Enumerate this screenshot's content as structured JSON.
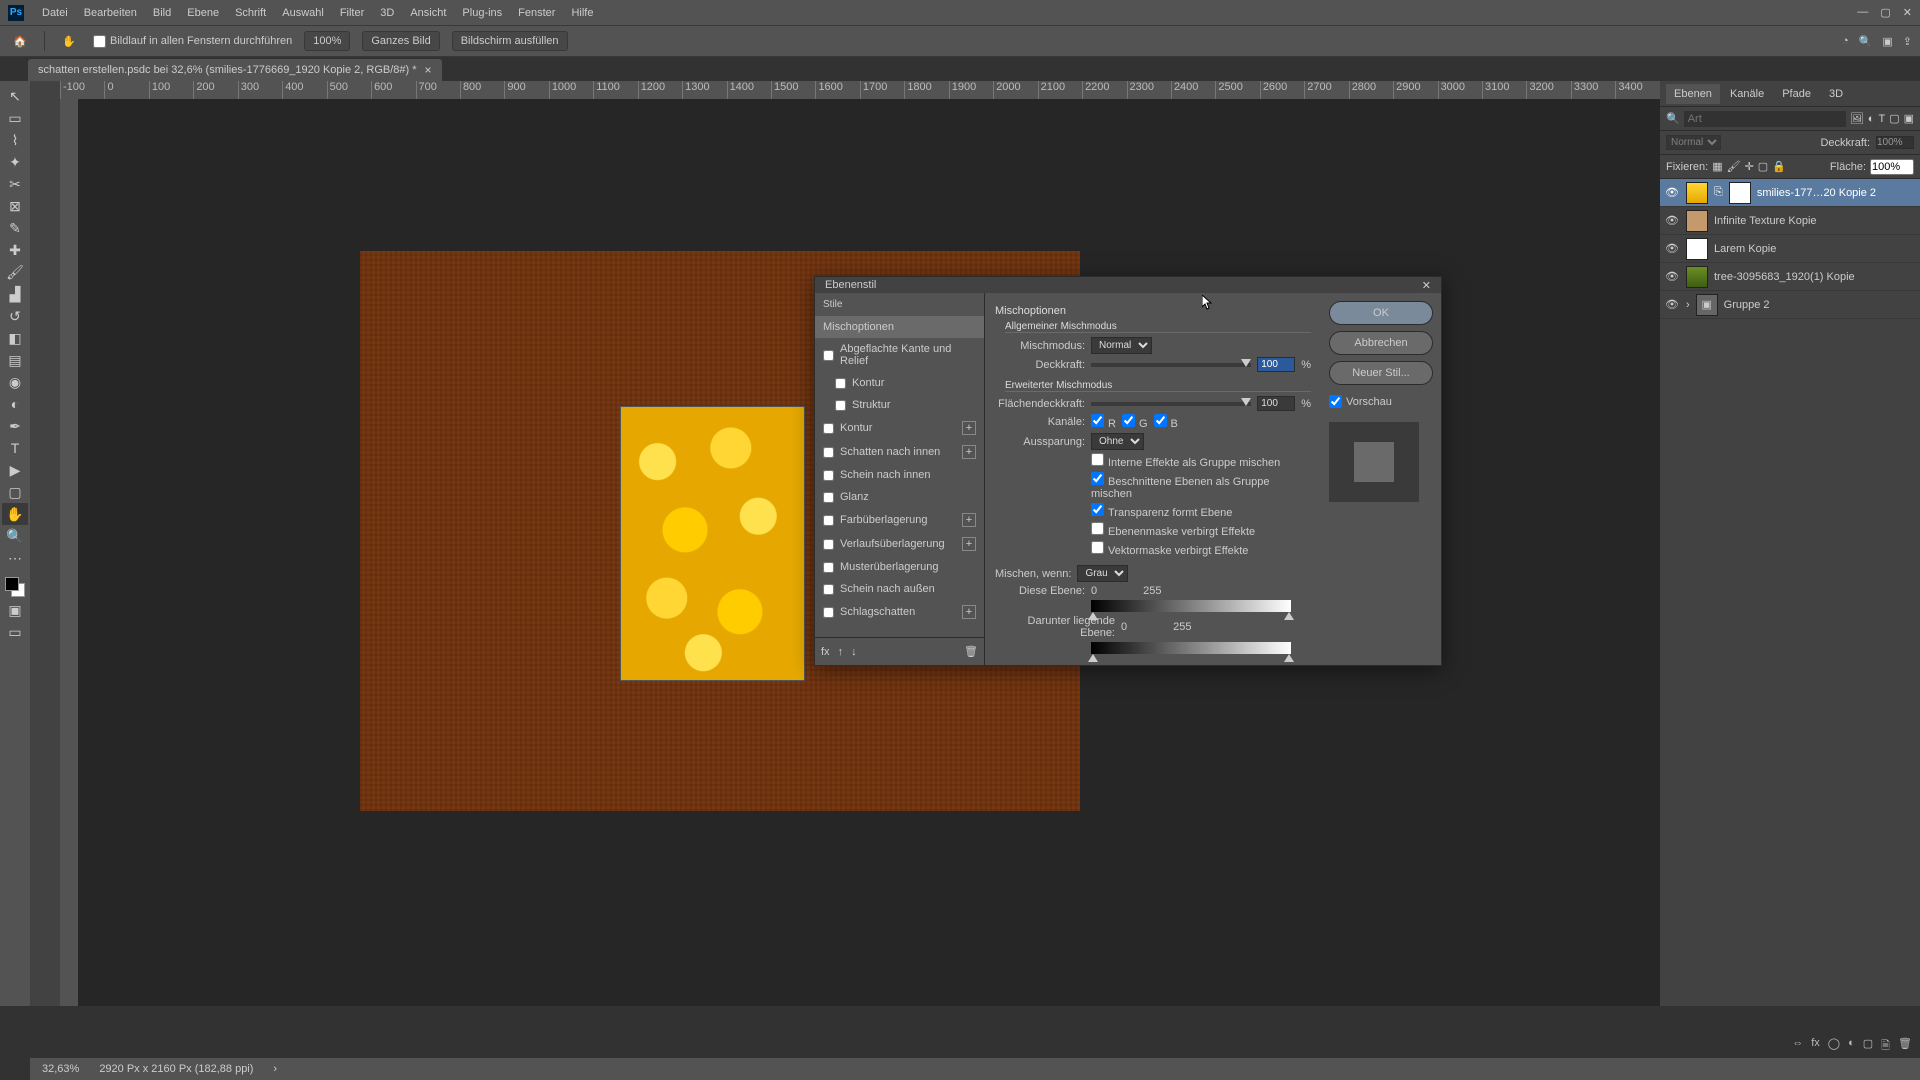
{
  "menubar": [
    "Datei",
    "Bearbeiten",
    "Bild",
    "Ebene",
    "Schrift",
    "Auswahl",
    "Filter",
    "3D",
    "Ansicht",
    "Plug-ins",
    "Fenster",
    "Hilfe"
  ],
  "optionsbar": {
    "scroll_all": "Bildlauf in allen Fenstern durchführen",
    "zoom100": "100%",
    "fit_screen": "Ganzes Bild",
    "fill_screen": "Bildschirm ausfüllen"
  },
  "doc_tab": {
    "title": "schatten erstellen.psdc bei 32,6% (smilies-1776669_1920 Kopie 2, RGB/8#) *"
  },
  "ruler_ticks": [
    "-100",
    "0",
    "100",
    "200",
    "300",
    "400",
    "500",
    "600",
    "700",
    "800",
    "900",
    "1000",
    "1100",
    "1200",
    "1300",
    "1400",
    "1500",
    "1600",
    "1700",
    "1800",
    "1900",
    "2000",
    "2100",
    "2200",
    "2300",
    "2400",
    "2500",
    "2600",
    "2700",
    "2800",
    "2900",
    "3000",
    "3100",
    "3200",
    "3300",
    "3400"
  ],
  "panels": {
    "tabs": [
      "Ebenen",
      "Kanäle",
      "Pfade",
      "3D"
    ],
    "search_placeholder": "Art",
    "blend_mode": "Normal",
    "opacity_label": "Deckkraft:",
    "opacity_value": "100%",
    "lock_label": "Fixieren:",
    "fill_label": "Fläche:",
    "fill_value": "100%",
    "layers": [
      {
        "name": "smilies-177…20 Kopie 2",
        "selected": true,
        "thumb": "emoji",
        "mask": true
      },
      {
        "name": "Infinite Texture Kopie",
        "thumb": "burlap"
      },
      {
        "name": "Larem Kopie",
        "thumb": "white"
      },
      {
        "name": "tree-3095683_1920(1) Kopie",
        "thumb": "tree"
      },
      {
        "name": "Gruppe 2",
        "folder": true
      }
    ]
  },
  "modal": {
    "title": "Ebenenstil",
    "styles_header": "Stile",
    "style_items": [
      {
        "label": "Mischoptionen",
        "active": true
      },
      {
        "label": "Abgeflachte Kante und Relief",
        "chk": true
      },
      {
        "label": "Kontur",
        "chk": true,
        "indent": true
      },
      {
        "label": "Struktur",
        "chk": true,
        "indent": true
      },
      {
        "label": "Kontur",
        "chk": true,
        "plus": true
      },
      {
        "label": "Schatten nach innen",
        "chk": true,
        "plus": true
      },
      {
        "label": "Schein nach innen",
        "chk": true
      },
      {
        "label": "Glanz",
        "chk": true
      },
      {
        "label": "Farbüberlagerung",
        "chk": true,
        "plus": true
      },
      {
        "label": "Verlaufsüberlagerung",
        "chk": true,
        "plus": true
      },
      {
        "label": "Musterüberlagerung",
        "chk": true
      },
      {
        "label": "Schein nach außen",
        "chk": true
      },
      {
        "label": "Schlagschatten",
        "chk": true,
        "plus": true
      }
    ],
    "opts": {
      "section": "Mischoptionen",
      "general_title": "Allgemeiner Mischmodus",
      "blend_label": "Mischmodus:",
      "blend_value": "Normal",
      "opacity_label": "Deckkraft:",
      "opacity_value": "100",
      "advanced_title": "Erweiterter Mischmodus",
      "fill_label": "Flächendeckkraft:",
      "fill_value": "100",
      "channels_label": "Kanäle:",
      "ch_r": "R",
      "ch_g": "G",
      "ch_b": "B",
      "knockout_label": "Aussparung:",
      "knockout_value": "Ohne",
      "chk1": "Interne Effekte als Gruppe mischen",
      "chk2": "Beschnittene Ebenen als Gruppe mischen",
      "chk3": "Transparenz formt Ebene",
      "chk4": "Ebenenmaske verbirgt Effekte",
      "chk5": "Vektormaske verbirgt Effekte",
      "blendif_label": "Mischen, wenn:",
      "blendif_value": "Grau",
      "this_layer": "Diese Ebene:",
      "this_lo": "0",
      "this_hi": "255",
      "under_layer": "Darunter liegende Ebene:",
      "under_lo": "0",
      "under_hi": "255",
      "percent": "%"
    },
    "buttons": {
      "ok": "OK",
      "cancel": "Abbrechen",
      "new_style": "Neuer Stil...",
      "preview": "Vorschau"
    }
  },
  "status": {
    "zoom": "32,63%",
    "doc_info": "2920 Px x 2160 Px (182,88 ppi)"
  }
}
